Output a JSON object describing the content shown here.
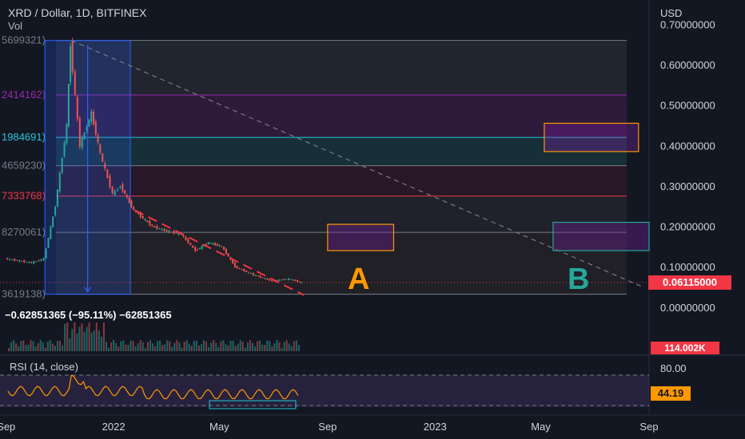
{
  "header": {
    "title": "XRD / Dollar, 1D, BITFINEX",
    "volume_label": "Vol"
  },
  "measure_text": "−0.62851365 (−95.11%) −62851365",
  "current_price": "0.06115000",
  "volume_value": "114.002K",
  "rsi": {
    "title": "RSI (14, close)",
    "value": "44.19",
    "upper_tick": "80.00"
  },
  "fib_left_labels": [
    "5699321)",
    "2414162)",
    "1984691)",
    "4659230)",
    "7333768)",
    "8270061)",
    "3619138)"
  ],
  "annotations": {
    "a": "A",
    "b": "B"
  },
  "colors": {
    "up": "#26a69a",
    "down": "#ef5350",
    "orange": "#ff9800",
    "price_tag": "#f23645"
  },
  "chart_data": {
    "type": "candlestick",
    "title": "XRD / Dollar, 1D, BITFINEX",
    "currency": "USD",
    "ylim": [
      -0.02,
      0.76
    ],
    "y_ticks": [
      "0.70000000",
      "0.60000000",
      "0.50000000",
      "0.40000000",
      "0.30000000",
      "0.20000000",
      "0.10000000",
      "0.00000000"
    ],
    "x_ticks": [
      "Sep",
      "2022",
      "May",
      "Sep",
      "2023",
      "May",
      "Sep"
    ],
    "x_tick_dates": [
      "2021-09-01",
      "2022-01-01",
      "2022-05-01",
      "2022-09-01",
      "2023-01-01",
      "2023-05-01",
      "2023-09-01"
    ],
    "x_range": [
      "2021-08-25",
      "2023-09-01"
    ],
    "price_series": [
      {
        "date": "2021-09-01",
        "close": 0.12
      },
      {
        "date": "2021-10-01",
        "close": 0.11
      },
      {
        "date": "2021-10-15",
        "close": 0.12
      },
      {
        "date": "2021-10-28",
        "close": 0.25
      },
      {
        "date": "2021-11-10",
        "close": 0.45
      },
      {
        "date": "2021-11-14",
        "close": 0.65
      },
      {
        "date": "2021-11-25",
        "close": 0.4
      },
      {
        "date": "2021-12-08",
        "close": 0.48
      },
      {
        "date": "2021-12-18",
        "close": 0.38
      },
      {
        "date": "2022-01-01",
        "close": 0.28
      },
      {
        "date": "2022-01-10",
        "close": 0.3
      },
      {
        "date": "2022-01-25",
        "close": 0.24
      },
      {
        "date": "2022-02-15",
        "close": 0.2
      },
      {
        "date": "2022-03-01",
        "close": 0.19
      },
      {
        "date": "2022-03-20",
        "close": 0.18
      },
      {
        "date": "2022-04-05",
        "close": 0.14
      },
      {
        "date": "2022-04-20",
        "close": 0.16
      },
      {
        "date": "2022-05-05",
        "close": 0.15
      },
      {
        "date": "2022-05-20",
        "close": 0.1
      },
      {
        "date": "2022-06-10",
        "close": 0.08
      },
      {
        "date": "2022-07-01",
        "close": 0.065
      },
      {
        "date": "2022-07-20",
        "close": 0.07
      },
      {
        "date": "2022-08-04",
        "close": 0.061
      }
    ],
    "fib_levels": [
      0.66,
      0.525,
      0.42,
      0.35,
      0.275,
      0.185,
      0.032
    ],
    "drawn_lines": [
      {
        "name": "descending-trendline",
        "from": {
          "date": "2021-11-14",
          "price": 0.66
        },
        "to": {
          "date": "2023-08-25",
          "price": 0.05
        }
      },
      {
        "name": "red-dashed-resistance",
        "from": {
          "date": "2022-01-25",
          "price": 0.24
        },
        "to": {
          "date": "2022-08-05",
          "price": 0.03
        }
      }
    ],
    "boxes": [
      {
        "name": "measure-box",
        "from": {
          "date": "2021-10-15",
          "price": 0.66
        },
        "to": {
          "date": "2022-01-20",
          "price": 0.032
        }
      },
      {
        "name": "box-a",
        "from": {
          "date": "2022-09-01",
          "price": 0.205
        },
        "to": {
          "date": "2022-11-15",
          "price": 0.14
        }
      },
      {
        "name": "box-b-top",
        "from": {
          "date": "2023-05-05",
          "price": 0.455
        },
        "to": {
          "date": "2023-08-20",
          "price": 0.385
        }
      },
      {
        "name": "box-b-bottom",
        "from": {
          "date": "2023-05-15",
          "price": 0.21
        },
        "to": {
          "date": "2023-09-01",
          "price": 0.14
        }
      }
    ],
    "rsi_bounds": [
      30,
      70
    ],
    "rsi_series_close": 44.19
  }
}
